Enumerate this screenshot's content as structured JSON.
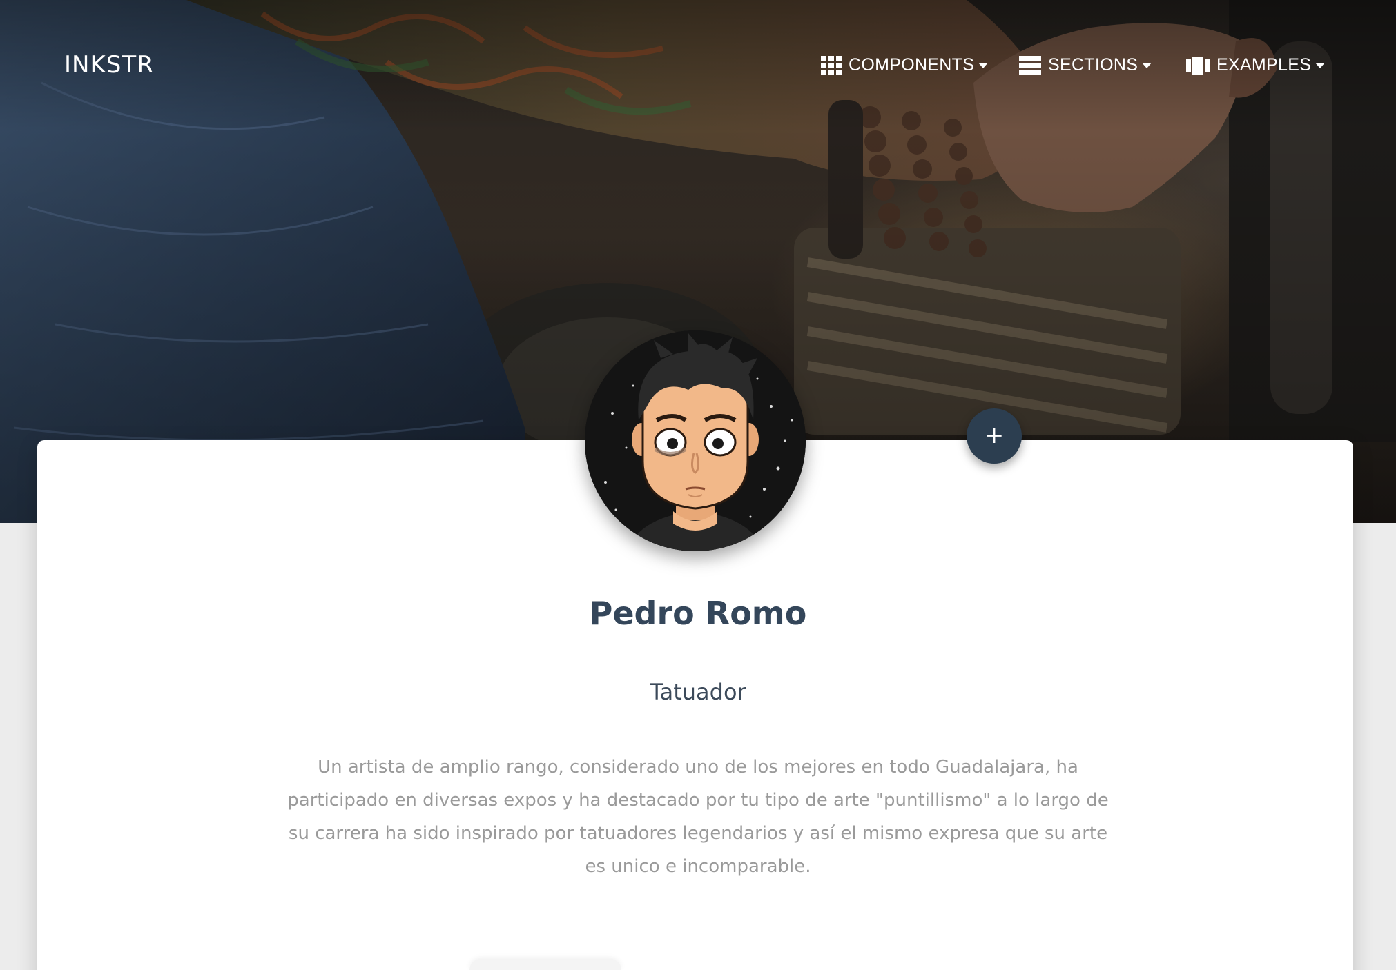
{
  "navbar": {
    "brand": "INKSTR",
    "items": [
      {
        "label": "COMPONENTS",
        "icon": "grid-icon"
      },
      {
        "label": "SECTIONS",
        "icon": "rows-icon"
      },
      {
        "label": "EXAMPLES",
        "icon": "columns-icon"
      }
    ]
  },
  "profile": {
    "name": "Pedro Romo",
    "role": "Tatuador",
    "bio": "Un artista de amplio rango, considerado uno de los mejores en todo Guadalajara, ha participado en diversas expos y ha destacado por tu tipo de arte \"puntillismo\" a lo largo de su carrera ha sido inspirado por tatuadores legendarios y así el mismo expresa que su arte es unico e incomparable.",
    "add_label": "+"
  },
  "colors": {
    "accent": "#2c3e50",
    "name_text": "#34465a",
    "bio_text": "#9a9a9a"
  }
}
